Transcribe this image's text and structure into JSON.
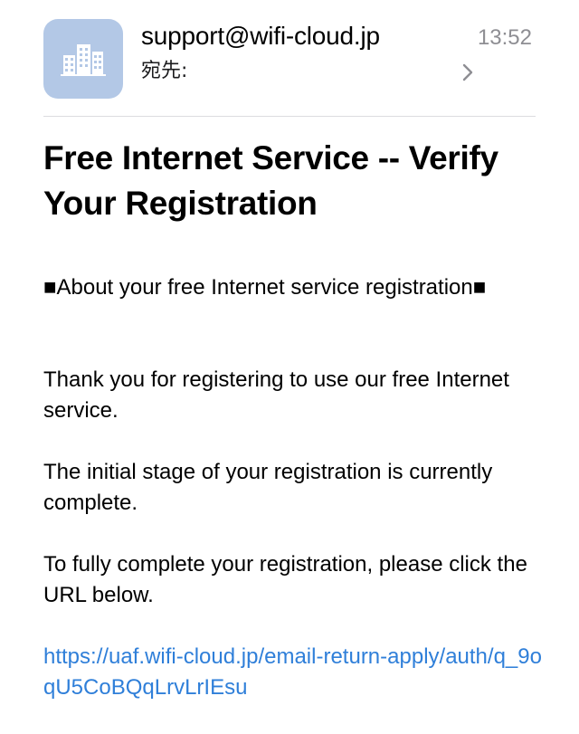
{
  "header": {
    "avatar_icon": "building-icon",
    "avatar_color": "#b3c8e6",
    "sender": "support@wifi-cloud.jp",
    "time": "13:52",
    "to_label": "宛先:",
    "chevron_icon": "chevron-right-icon"
  },
  "email": {
    "subject": "Free Internet Service -- Verify Your Registration",
    "paragraphs": [
      "■About your free Internet service registration■",
      "Thank you for registering to use our free Internet service.",
      "The initial stage of your registration is currently complete.",
      "To fully complete your registration, please click the URL below."
    ],
    "link": "https://uaf.wifi-cloud.jp/email-return-apply/auth/q_9oqU5CoBQqLrvLrIEsu",
    "link_color": "#2f7fd9"
  }
}
